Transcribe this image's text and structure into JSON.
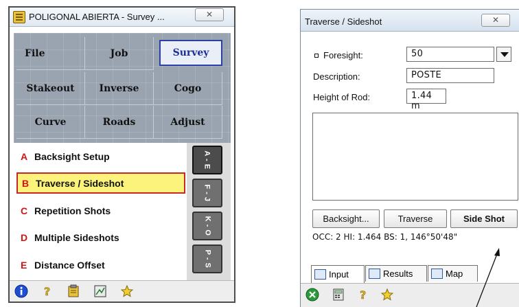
{
  "left_window": {
    "title": "POLIGONAL ABIERTA - Survey ...",
    "close_label": "✕",
    "menu": [
      {
        "label": "File",
        "selected": false
      },
      {
        "label": "Job",
        "selected": false
      },
      {
        "label": "Survey",
        "selected": true
      },
      {
        "label": "Stakeout",
        "selected": false
      },
      {
        "label": "Inverse",
        "selected": false
      },
      {
        "label": "Cogo",
        "selected": false
      },
      {
        "label": "Curve",
        "selected": false
      },
      {
        "label": "Roads",
        "selected": false
      },
      {
        "label": "Adjust",
        "selected": false
      }
    ],
    "list": [
      {
        "letter": "A",
        "label": "Backsight Setup",
        "selected": false
      },
      {
        "letter": "B",
        "label": "Traverse / Sideshot",
        "selected": true
      },
      {
        "letter": "C",
        "label": "Repetition Shots",
        "selected": false
      },
      {
        "letter": "D",
        "label": "Multiple Sideshots",
        "selected": false
      },
      {
        "letter": "E",
        "label": "Distance Offset",
        "selected": false
      }
    ],
    "side_tabs": [
      "A - E",
      "F - J",
      "K - O",
      "P - S"
    ],
    "toolbar_icons": [
      "info-icon",
      "help-icon",
      "clipboard-icon",
      "map-icon",
      "favorites-icon"
    ]
  },
  "right_window": {
    "title": "Traverse / Sideshot",
    "close_label": "✕",
    "foresight_label": "Foresight:",
    "foresight_value": "50",
    "description_label": "Description:",
    "description_value": "POSTE",
    "rod_label": "Height of Rod:",
    "rod_value": "1.44 m",
    "buttons": {
      "backsight": "Backsight...",
      "traverse": "Traverse",
      "sideshot": "Side Shot"
    },
    "status": "OCC: 2  HI: 1.464  BS: 1, 146°50'48\"",
    "tabs": {
      "input": "Input",
      "results": "Results",
      "map": "Map"
    },
    "toolbar_icons": [
      "ok-icon",
      "calculator-icon",
      "help-icon",
      "favorites-icon"
    ]
  },
  "colors": {
    "list_highlight": "#fbf37c",
    "list_highlight_border": "#c62828",
    "letter_red": "#d11414",
    "menu_bg": "#9aa3b0",
    "selected_menu_border": "#2a3fa8"
  }
}
